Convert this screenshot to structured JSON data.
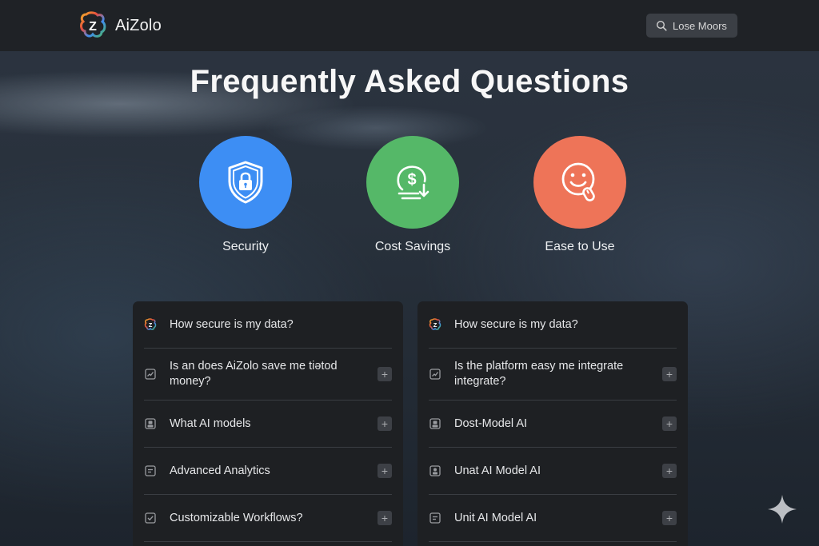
{
  "header": {
    "brand": "AiZolo",
    "logo_icon": "aizolo-logo-icon",
    "search_label": "Lose Moors"
  },
  "page_title": "Frequently Asked Questions",
  "features": [
    {
      "label": "Security",
      "icon": "shield-lock-icon",
      "color": "#3d8ef4"
    },
    {
      "label": "Cost Savings",
      "icon": "dollar-coin-icon",
      "color": "#55b868"
    },
    {
      "label": "Ease to Use",
      "icon": "smiley-cursor-icon",
      "color": "#ee7458"
    }
  ],
  "faq_left": [
    {
      "question": "How secure is my data?",
      "icon": "aizolo-logo-icon"
    },
    {
      "question": "Is an does AiZolo save me tiәtod money?",
      "icon": "chart-icon"
    },
    {
      "question": "What AI models",
      "icon": "model-icon"
    },
    {
      "question": "Advanced Analytics",
      "icon": "analytics-icon"
    },
    {
      "question": "Customizable Workflows?",
      "icon": "workflow-icon"
    }
  ],
  "faq_right": [
    {
      "question": "How secure is my data?",
      "icon": "aizolo-logo-icon"
    },
    {
      "question": "Is the platform easy me integrate integrate?",
      "icon": "chart-icon"
    },
    {
      "question": "Dost-Model AI",
      "icon": "model-icon"
    },
    {
      "question": "Unat AI Model AI",
      "icon": "model-icon"
    },
    {
      "question": "Unit AI Model AI",
      "icon": "analytics-icon"
    }
  ],
  "expand_symbol": "+",
  "colors": {
    "header_bg": "#1f2226",
    "panel_bg": "#1e2023",
    "security": "#3d8ef4",
    "cost": "#55b868",
    "ease": "#ee7458"
  }
}
